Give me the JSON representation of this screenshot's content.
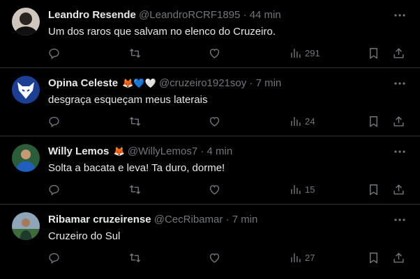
{
  "colors": {
    "background": "#000000",
    "text": "#e7e9ea",
    "muted": "#71767b",
    "divider": "#2f3336"
  },
  "tweets": [
    {
      "name": "Leandro Resende",
      "emojis": "",
      "handle": "@LeandroRCRF1895",
      "dot": "·",
      "time": "44 min",
      "text": "Um dos raros que salvam no elenco do Cruzeiro.",
      "views": "291",
      "avatar": "person-avatar"
    },
    {
      "name": "Opina Celeste",
      "emojis": "🦊💙🤍",
      "handle": "@cruzeiro1921soy",
      "dot": "·",
      "time": "7 min",
      "text": "desgraça esqueçam meus laterais",
      "views": "24",
      "avatar": "fox-logo-avatar"
    },
    {
      "name": "Willy Lemos",
      "emojis": "🦊",
      "handle": "@WillyLemos7",
      "dot": "·",
      "time": "4 min",
      "text": "Solta a bacata e leva! Ta duro, dorme!",
      "views": "15",
      "avatar": "person-avatar"
    },
    {
      "name": "Ribamar cruzeirense",
      "emojis": "",
      "handle": "@CecRibamar",
      "dot": "·",
      "time": "7 min",
      "text": "Cruzeiro do Sul",
      "views": "27",
      "avatar": "person-avatar"
    }
  ]
}
